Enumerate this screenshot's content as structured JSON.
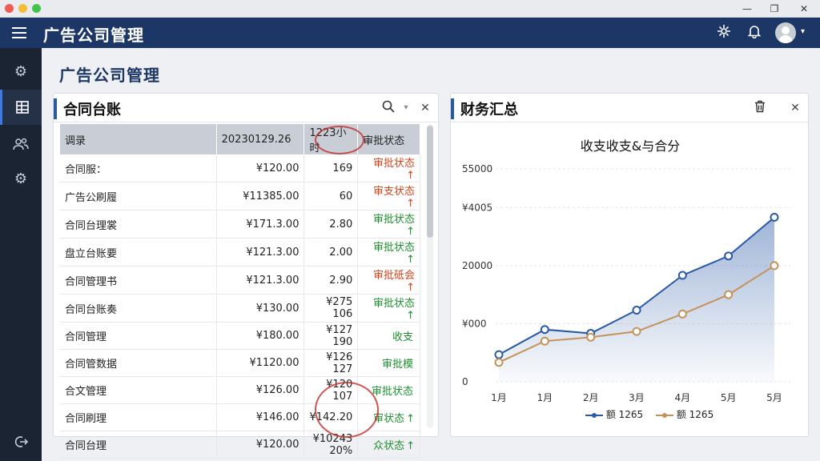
{
  "app": {
    "title": "广告公司管理"
  },
  "page": {
    "title": "广告公司管理"
  },
  "icons": {
    "menu": "hamburger-icon",
    "network": "network-icon",
    "bell": "bell-icon",
    "avatar": "user-avatar-icon",
    "search": "search-icon",
    "close": "close-icon",
    "trash": "trash-icon"
  },
  "colors": {
    "header": "#1c3766",
    "sidebar": "#1a2433",
    "accent": "#2a5aa6",
    "ok": "#1e8f2e",
    "warn": "#d4451c"
  },
  "contract_panel": {
    "title": "合同台账",
    "columns": [
      "调录",
      "202301​29.26",
      "1223小时",
      "审批状态"
    ],
    "rows": [
      {
        "name": "合同服：",
        "amount": "¥120.00",
        "qty": "169",
        "status": "审批状态",
        "arrow": "↑",
        "kind": "warn"
      },
      {
        "name": "广告公刷履",
        "amount": "¥11385.00",
        "qty": "60",
        "status": "审支状态",
        "arrow": "↑",
        "kind": "warn"
      },
      {
        "name": "合同台理裳",
        "amount": "¥171.3.00",
        "qty": "2.80",
        "status": "审批状态",
        "arrow": "↑",
        "kind": "ok"
      },
      {
        "name": "盘立台账要",
        "amount": "¥121.3.00",
        "qty": "2.00",
        "status": "审批状态",
        "arrow": "↑",
        "kind": "ok"
      },
      {
        "name": "合同管理书",
        "amount": "¥121.3.00",
        "qty": "2.90",
        "status": "审批砥会",
        "arrow": "↑",
        "kind": "warn"
      },
      {
        "name": "合同台账奏",
        "amount": "¥130.00",
        "qty": "¥275 106",
        "status": "审批状态",
        "arrow": "↑",
        "kind": "ok"
      },
      {
        "name": "合同管理",
        "amount": "¥180.00",
        "qty": "¥127 190",
        "status": "收支",
        "arrow": "",
        "kind": "ok"
      },
      {
        "name": "合同管数据",
        "amount": "¥1120.00",
        "qty": "¥126 127",
        "status": "审批模",
        "arrow": "",
        "kind": "ok"
      },
      {
        "name": "合文管理",
        "amount": "¥126.00",
        "qty": "¥120 107",
        "status": "审批状态",
        "arrow": "",
        "kind": "ok"
      },
      {
        "name": "合同刷理",
        "amount": "¥146.00",
        "qty": "¥142.20",
        "status": "审状态",
        "arrow": "↑",
        "kind": "ok"
      },
      {
        "name": "合同台理",
        "amount": "¥120.00",
        "qty": "¥10243 20%",
        "status": "众状态",
        "arrow": "↑",
        "kind": "ok"
      }
    ]
  },
  "finance_panel": {
    "title": "财务汇总"
  },
  "chart_data": {
    "type": "line",
    "title": "收支收支&与合分",
    "categories": [
      "1月",
      "1月",
      "2月",
      "3月",
      "4月",
      "5月",
      "5月"
    ],
    "y_tick_labels": [
      "55000",
      "¥4005",
      "20000",
      "¥000",
      "0"
    ],
    "y_tick_values": [
      55000,
      45000,
      30000,
      15000,
      0
    ],
    "ylim": [
      0,
      55000
    ],
    "grid": true,
    "legend_position": "bottom",
    "series": [
      {
        "name": "额 1265",
        "color": "#2a5aa6",
        "area": true,
        "values": [
          7000,
          13500,
          12500,
          18500,
          27500,
          32500,
          42500
        ]
      },
      {
        "name": "额 1265",
        "color": "#c4935a",
        "area": false,
        "values": [
          5000,
          10500,
          11500,
          13000,
          17500,
          22500,
          30000
        ]
      }
    ]
  }
}
